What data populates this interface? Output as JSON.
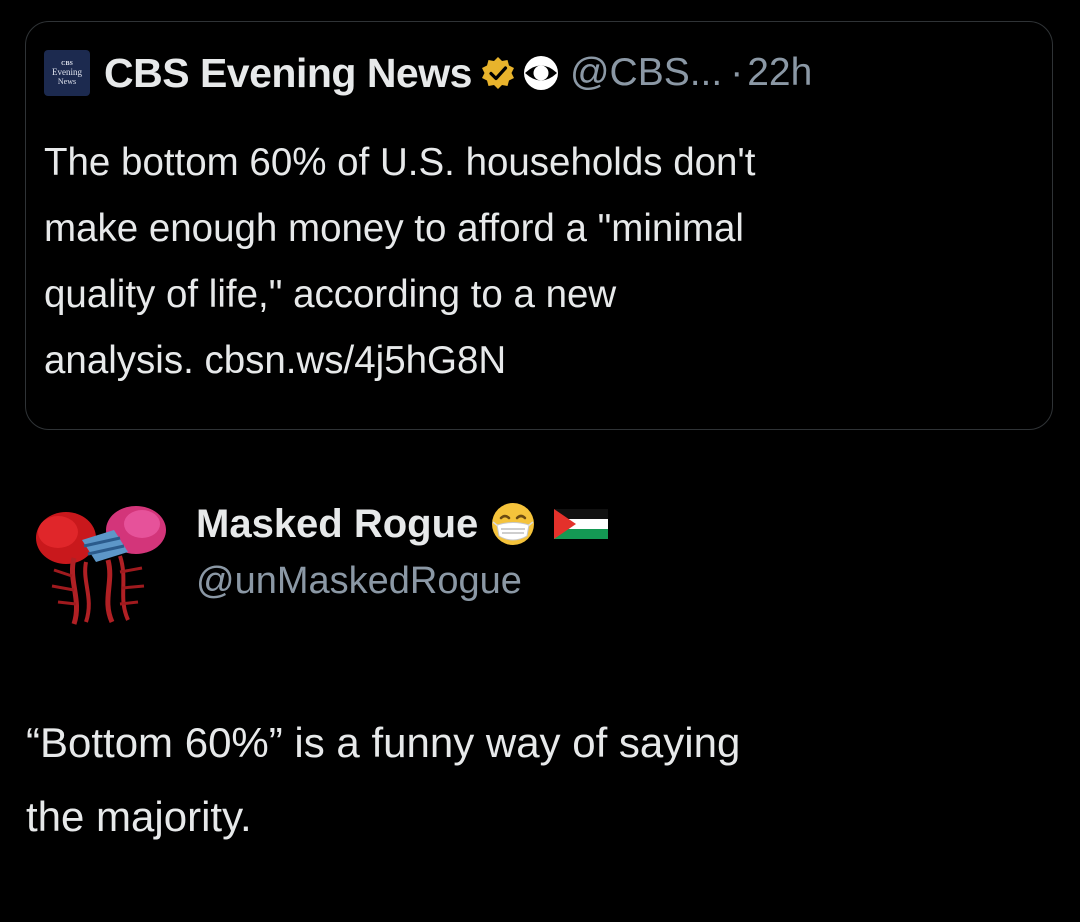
{
  "quoted_post": {
    "avatar_lines": [
      "CBS",
      "Evening",
      "News"
    ],
    "author_name": "CBS Evening News",
    "handle": "@CBS...",
    "separator": "·",
    "time": "22h",
    "text": "The bottom 60% of U.S. households don't\nmake enough money to afford a \"minimal\nquality of life,\" according to a new\nanalysis. cbsn.ws/4j5hG8N",
    "verified_badge_color": "#e8b32c",
    "badges": [
      "verified-gold-icon",
      "cbs-eye-logo-icon"
    ]
  },
  "reply_post": {
    "author_name": "Masked Rogue",
    "handle": "@unMaskedRogue",
    "text": "“Bottom 60%” is a funny way of saying\nthe majority.",
    "name_emojis": [
      "face-with-medical-mask-icon",
      "palestine-flag-icon"
    ]
  },
  "colors": {
    "background": "#000000",
    "primary_text": "#e7e9ea",
    "secondary_text": "#8b98a5",
    "card_border": "#2f3336"
  }
}
